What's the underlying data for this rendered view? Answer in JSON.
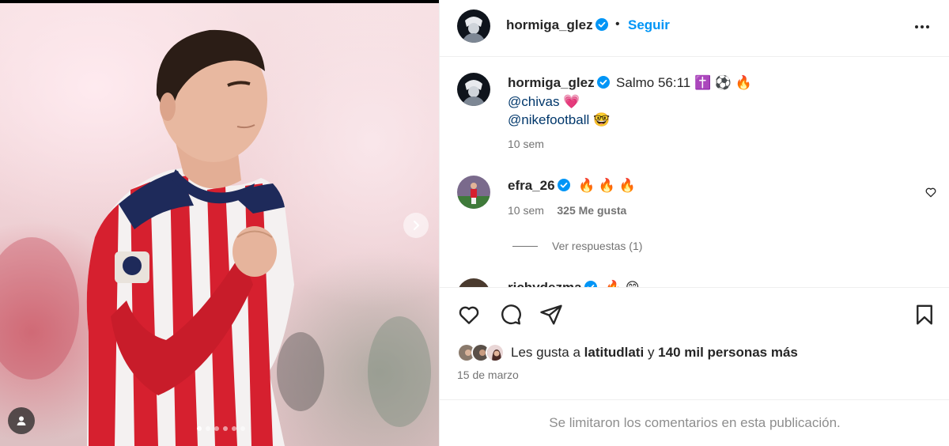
{
  "post": {
    "author": "hormiga_glez",
    "follow_label": "Seguir",
    "bullet": "•",
    "caption": {
      "username": "hormiga_glez",
      "text": "Salmo 56:11 ✝️ ⚽ 🔥",
      "mention_1": "@chivas",
      "mention_1_emoji": "💗",
      "mention_2": "@nikefootball",
      "mention_2_emoji": "🤓",
      "time": "10 sem"
    },
    "comments": [
      {
        "username": "efra_26",
        "text": "🔥 🔥 🔥",
        "time": "10 sem",
        "likes": "325 Me gusta",
        "replies_label": "Ver respuestas (1)"
      },
      {
        "username": "richydezma",
        "text": "🔥 😁"
      }
    ],
    "likes": {
      "prefix": "Les gusta a",
      "first_user": "latitudlati",
      "connector": "y",
      "others": "140 mil personas más"
    },
    "date": "15 de marzo",
    "comments_limited": "Se limitaron los comentarios en esta publicación."
  },
  "carousel": {
    "slide_count": 6,
    "active_index": 0
  },
  "colors": {
    "accent": "#0095f6",
    "mention": "#00376b",
    "muted": "#737373",
    "text": "#262626",
    "jersey_red": "#d6202f",
    "jersey_navy": "#1e2a5a"
  },
  "icons": [
    "verified-badge-icon",
    "more-options-icon",
    "heart-icon",
    "comment-icon",
    "share-icon",
    "bookmark-icon",
    "chevron-right-icon",
    "person-tag-icon"
  ]
}
